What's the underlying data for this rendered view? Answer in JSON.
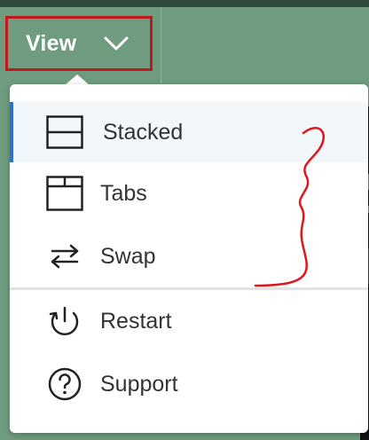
{
  "view_button": {
    "label": "View"
  },
  "menu": {
    "items": [
      {
        "label": "Stacked",
        "icon": "stacked-layout-icon",
        "selected": true
      },
      {
        "label": "Tabs",
        "icon": "tabs-layout-icon",
        "selected": false
      },
      {
        "label": "Swap",
        "icon": "swap-arrows-icon",
        "selected": false
      },
      {
        "label": "Restart",
        "icon": "restart-power-icon",
        "selected": false
      },
      {
        "label": "Support",
        "icon": "help-circle-icon",
        "selected": false
      }
    ]
  },
  "colors": {
    "background": "#6f9c7f",
    "highlight_border": "#c0191f",
    "selected_accent": "#2f6fd6",
    "annotation": "#e0161c"
  }
}
